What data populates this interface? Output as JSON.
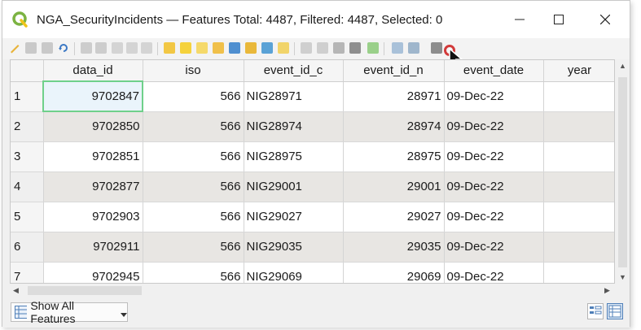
{
  "window": {
    "title": "NGA_SecurityIncidents — Features Total: 4487, Filtered: 4487, Selected: 0",
    "controls": {
      "minimize": "–",
      "maximize": "☐",
      "close": "✕"
    }
  },
  "table": {
    "columns": [
      "data_id",
      "iso",
      "event_id_c",
      "event_id_n",
      "event_date",
      "year"
    ],
    "rows": [
      {
        "n": "1",
        "data_id": "9702847",
        "iso": "566",
        "event_id_c": "NIG28971",
        "event_id_n": "28971",
        "event_date": "09-Dec-22",
        "year": ""
      },
      {
        "n": "2",
        "data_id": "9702850",
        "iso": "566",
        "event_id_c": "NIG28974",
        "event_id_n": "28974",
        "event_date": "09-Dec-22",
        "year": ""
      },
      {
        "n": "3",
        "data_id": "9702851",
        "iso": "566",
        "event_id_c": "NIG28975",
        "event_id_n": "28975",
        "event_date": "09-Dec-22",
        "year": ""
      },
      {
        "n": "4",
        "data_id": "9702877",
        "iso": "566",
        "event_id_c": "NIG29001",
        "event_id_n": "29001",
        "event_date": "09-Dec-22",
        "year": ""
      },
      {
        "n": "5",
        "data_id": "9702903",
        "iso": "566",
        "event_id_c": "NIG29027",
        "event_id_n": "29027",
        "event_date": "09-Dec-22",
        "year": ""
      },
      {
        "n": "6",
        "data_id": "9702911",
        "iso": "566",
        "event_id_c": "NIG29035",
        "event_id_n": "29035",
        "event_date": "09-Dec-22",
        "year": ""
      },
      {
        "n": "7",
        "data_id": "9702945",
        "iso": "566",
        "event_id_c": "NIG29069",
        "event_id_n": "29069",
        "event_date": "09-Dec-22",
        "year": ""
      }
    ]
  },
  "bottombar": {
    "filter_label": "Show All Features"
  },
  "colors": {
    "accent_focus": "#6fd08a",
    "alt_row": "#e8e6e3",
    "logo_green": "#7cb342"
  }
}
